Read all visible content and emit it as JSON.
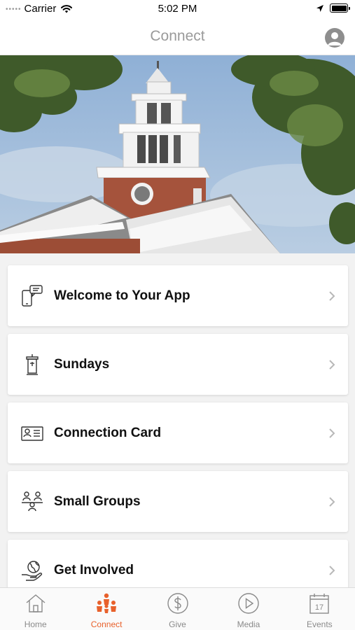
{
  "status_bar": {
    "carrier": "Carrier",
    "time": "5:02 PM",
    "signal_dots": "•••••"
  },
  "nav": {
    "title": "Connect"
  },
  "menu": [
    {
      "label": "Welcome to Your App",
      "icon": "phone-chat-icon"
    },
    {
      "label": "Sundays",
      "icon": "pulpit-icon"
    },
    {
      "label": "Connection Card",
      "icon": "id-card-icon"
    },
    {
      "label": "Small Groups",
      "icon": "people-group-icon"
    },
    {
      "label": "Get Involved",
      "icon": "hand-globe-icon"
    }
  ],
  "tabs": [
    {
      "label": "Home",
      "icon": "home-icon",
      "active": false
    },
    {
      "label": "Connect",
      "icon": "connect-people-icon",
      "active": true
    },
    {
      "label": "Give",
      "icon": "dollar-icon",
      "active": false
    },
    {
      "label": "Media",
      "icon": "play-icon",
      "active": false
    },
    {
      "label": "Events",
      "icon": "calendar-icon",
      "active": false
    }
  ],
  "calendar_day": "17",
  "colors": {
    "accent": "#e8612c",
    "inactive": "#8a8a8a",
    "background": "#f2f2f2"
  }
}
